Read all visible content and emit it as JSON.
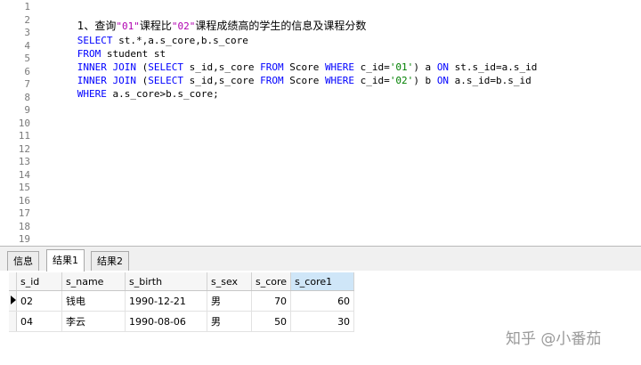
{
  "editor": {
    "line_numbers": [
      "1",
      "2",
      "3",
      "4",
      "5",
      "6",
      "7",
      "8",
      "9",
      "10",
      "11",
      "12",
      "13",
      "14",
      "15",
      "16",
      "17",
      "18",
      "19"
    ],
    "lines": [
      {
        "comment_pre": "1、查询",
        "q1": "\"01\"",
        "comment_mid": "课程比",
        "q2": "\"02\"",
        "comment_post": "课程成绩高的学生的信息及课程分数"
      },
      {
        "k1": "SELECT",
        "t1": " st.*,a.s_core,b.s_core"
      },
      {
        "k1": "FROM",
        "t1": " student st"
      },
      {
        "k1": "INNER JOIN",
        "t1": " (",
        "k2": "SELECT",
        "t2": " s_id,s_core ",
        "k3": "FROM",
        "t3": " Score ",
        "k4": "WHERE",
        "t4": " c_id=",
        "s1": "'01'",
        "t5": ") a ",
        "k5": "ON",
        "t6": " st.s_id=a.s_id"
      },
      {
        "k1": "INNER JOIN",
        "t1": " (",
        "k2": "SELECT",
        "t2": " s_id,s_core ",
        "k3": "FROM",
        "t3": " Score ",
        "k4": "WHERE",
        "t4": " c_id=",
        "s1": "'02'",
        "t5": ") b ",
        "k5": "ON",
        "t6": " a.s_id=b.s_id"
      },
      {
        "k1": "WHERE",
        "t1": " a.s_core>b.s_core;"
      }
    ]
  },
  "tabs": [
    {
      "label": "信息"
    },
    {
      "label": "结果1"
    },
    {
      "label": "结果2"
    }
  ],
  "active_tab": "结果1",
  "grid": {
    "columns": [
      "s_id",
      "s_name",
      "s_birth",
      "s_sex",
      "s_core",
      "s_core1"
    ],
    "rows": [
      [
        "02",
        "钱电",
        "1990-12-21",
        "男",
        "70",
        "60"
      ],
      [
        "04",
        "李云",
        "1990-08-06",
        "男",
        "50",
        "30"
      ]
    ]
  },
  "watermark": "知乎 @小番茄",
  "colors": {
    "keyword": "#0000ff",
    "string": "#008000",
    "quoted_in_comment": "#b000b0",
    "header_highlight": "#cfe6f8"
  }
}
